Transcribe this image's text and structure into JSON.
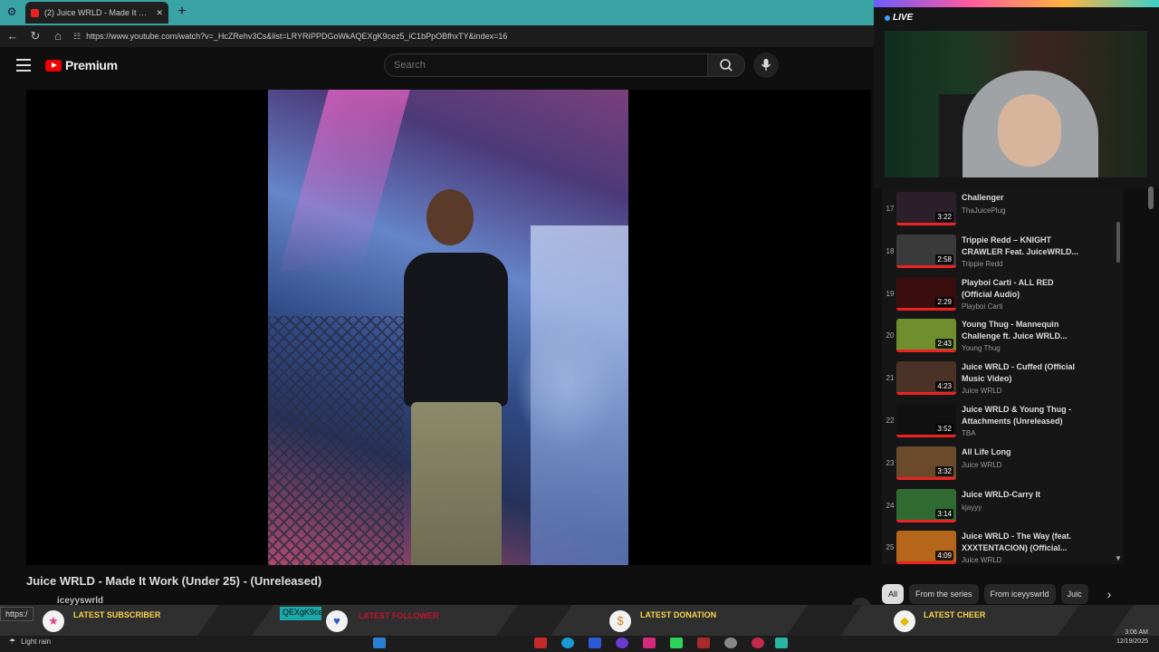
{
  "browser": {
    "tab_title": "(2) Juice WRLD - Made It Work (U...",
    "url": "https://www.youtube.com/watch?v=_HcZRehv3Cs&list=LRYRIPPDGoWkAQEXgK9cez5_iC1bPpOBfhxTY&index=16"
  },
  "youtube": {
    "logo_text": "Premium",
    "search_placeholder": "Search",
    "video_title": "Juice WRLD - Made It Work (Under 25) - (Unreleased)",
    "channel_name": "iceyyswrld"
  },
  "stream": {
    "live_label": "LIVE"
  },
  "playlist": {
    "items": [
      {
        "index": "17",
        "title": "Challenger",
        "channel": "ThaJuicePlug",
        "duration": "3:22",
        "color": "#2b1f2a"
      },
      {
        "index": "18",
        "title": "Trippie Redd – KNIGHT CRAWLER Feat. JuiceWRLD...",
        "channel": "Trippie Redd",
        "duration": "2:58",
        "color": "#3a3a3a"
      },
      {
        "index": "19",
        "title": "Playboi Carti - ALL RED (Official Audio)",
        "channel": "Playboi Carti",
        "duration": "2:29",
        "color": "#3a0d0d"
      },
      {
        "index": "20",
        "title": "Young Thug - Mannequin Challenge ft. Juice WRLD...",
        "channel": "Young Thug",
        "duration": "2:43",
        "color": "#6f8f2f"
      },
      {
        "index": "21",
        "title": "Juice WRLD - Cuffed (Official Music Video)",
        "channel": "Juice WRLD",
        "duration": "4:23",
        "color": "#4a3326"
      },
      {
        "index": "22",
        "title": "Juice WRLD & Young Thug - Attachments (Unreleased)",
        "channel": "TBA",
        "duration": "3:52",
        "color": "#111111"
      },
      {
        "index": "23",
        "title": "All Life Long",
        "channel": "Juice WRLD",
        "duration": "3:32",
        "color": "#6a4a2a"
      },
      {
        "index": "24",
        "title": "Juice WRLD-Carry It",
        "channel": "kjayyy",
        "duration": "3:14",
        "color": "#2f6a30"
      },
      {
        "index": "25",
        "title": "Juice WRLD - The Way (feat. XXXTENTACION) (Official...",
        "channel": "Juice WRLD",
        "duration": "4:09",
        "color": "#b5661a"
      }
    ]
  },
  "chips": [
    "All",
    "From the series",
    "From iceyyswrld",
    "Juic"
  ],
  "alerts": {
    "url_tooltip": "https:/",
    "tag_pill": "QEXgK9ce",
    "latest_subscriber": "LATEST SUBSCRIBER",
    "latest_follower": "LATEST FOLLOWER",
    "latest_donation": "LATEST DONATION",
    "latest_cheer": "LATEST CHEER"
  },
  "taskbar": {
    "weather": "Light rain",
    "time": "3:06 AM",
    "date": "12/19/2025"
  },
  "colors": {
    "accent_red": "#ff0000",
    "tab_strip": "#3aa3a3",
    "alert_label": "#f5d54a"
  }
}
